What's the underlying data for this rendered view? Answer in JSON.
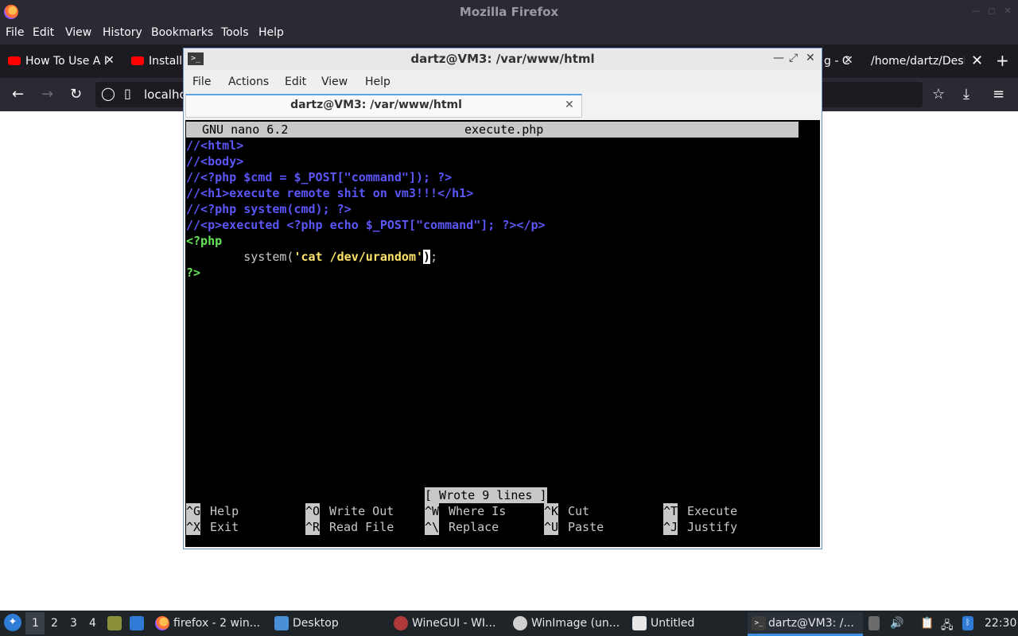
{
  "firefox": {
    "title": "Mozilla Firefox",
    "menu": [
      "File",
      "Edit",
      "View",
      "History",
      "Bookmarks",
      "Tools",
      "Help"
    ],
    "tabs": [
      {
        "label": "How To Use A I"
      },
      {
        "label": "Installi"
      },
      {
        "label": "g - C"
      },
      {
        "label": "/home/dartz/Desk"
      }
    ],
    "url": "localho",
    "icons": [
      "back-icon",
      "forward-icon",
      "reload-icon",
      "shield-icon",
      "page-icon",
      "bookmark-star-icon",
      "download-icon",
      "menu-icon"
    ]
  },
  "terminal": {
    "title": "dartz@VM3: /var/www/html",
    "menu": [
      "File",
      "Actions",
      "Edit",
      "View",
      "Help"
    ],
    "tab_label": "dartz@VM3: /var/www/html",
    "nano": {
      "version": "GNU nano 6.2",
      "filename": "execute.php",
      "lines": [
        "//<html>",
        "//<body>",
        "//<?php $cmd = $_POST[\"command\"]); ?>",
        "//<h1>execute remote shit on vm3!!!</h1>",
        "//<?php system(cmd); ?>",
        "//<p>executed <?php echo $_POST[\"command\"]; ?></p>",
        "<?php",
        "?>"
      ],
      "system_line": {
        "indent": "        ",
        "func": "system(",
        "str": "'cat /dev/urandom'",
        "cursor_char": ")",
        "tail": ";"
      },
      "status": "[ Wrote 9 lines ]",
      "shortcuts_row1": [
        {
          "key": "^G",
          "label": "Help"
        },
        {
          "key": "^O",
          "label": "Write Out"
        },
        {
          "key": "^W",
          "label": "Where Is"
        },
        {
          "key": "^K",
          "label": "Cut"
        },
        {
          "key": "^T",
          "label": "Execute"
        }
      ],
      "shortcuts_row2": [
        {
          "key": "^X",
          "label": "Exit"
        },
        {
          "key": "^R",
          "label": "Read File"
        },
        {
          "key": "^\\",
          "label": "Replace"
        },
        {
          "key": "^U",
          "label": "Paste"
        },
        {
          "key": "^J",
          "label": "Justify"
        }
      ]
    }
  },
  "taskbar": {
    "workspaces": [
      "1",
      "2",
      "3",
      "4"
    ],
    "items": [
      {
        "label": "firefox - 2 win..."
      },
      {
        "label": "Desktop"
      },
      {
        "label": "WineGUI - WI..."
      },
      {
        "label": "WinImage (un..."
      },
      {
        "label": "Untitled"
      },
      {
        "label": "dartz@VM3: /..."
      }
    ],
    "clock": "22:30"
  }
}
